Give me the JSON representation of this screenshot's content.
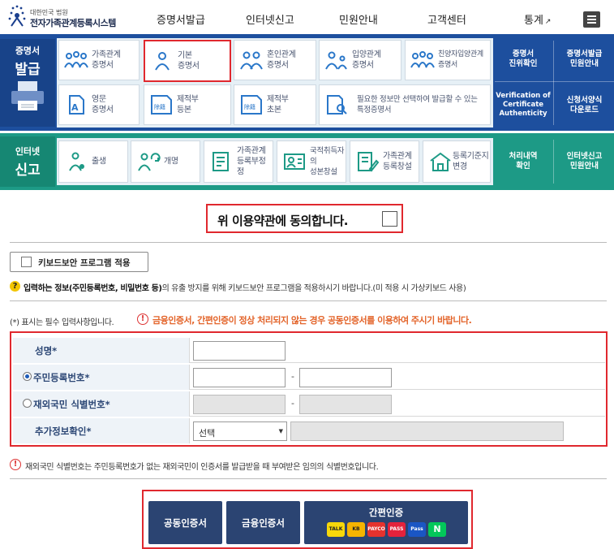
{
  "header": {
    "logo_small": "대한민국 법원",
    "logo_main": "전자가족관계등록시스템",
    "nav": [
      {
        "label": "증명서발급"
      },
      {
        "label": "인터넷신고"
      },
      {
        "label": "민원안내"
      },
      {
        "label": "고객센터"
      },
      {
        "label": "통계",
        "ext": "↗"
      }
    ]
  },
  "cert_section": {
    "title_small": "증명서",
    "title_big": "발급",
    "tiles": [
      {
        "label": "가족관계\n증명서",
        "icon": "family-icon"
      },
      {
        "label": "기본\n증명서",
        "icon": "person-icon",
        "selected": true
      },
      {
        "label": "혼인관계\n증명서",
        "icon": "couple-icon"
      },
      {
        "label": "입양관계\n증명서",
        "icon": "adoption-icon"
      },
      {
        "label": "친양자입양관계\n증명서",
        "icon": "family-icon"
      },
      {
        "label": "영문\n증명서",
        "icon": "english-doc-icon"
      },
      {
        "label": "제적부\n등본",
        "icon": "register-icon"
      },
      {
        "label": "제적부\n초본",
        "icon": "register-icon"
      },
      {
        "label": "필요한 정보만 선택하여 발급할 수 있는\n특정증명서",
        "icon": "search-doc-icon"
      }
    ],
    "side": [
      {
        "label": "증명서\n진위확인"
      },
      {
        "label": "증명서발급\n민원안내"
      },
      {
        "label": "Verification of\nCertificate\nAuthenticity"
      },
      {
        "label": "신청서양식\n다운로드"
      }
    ]
  },
  "report_section": {
    "title_small": "인터넷",
    "title_big": "신고",
    "tiles": [
      {
        "label": "출생",
        "icon": "birth-icon"
      },
      {
        "label": "개명",
        "icon": "rename-icon"
      },
      {
        "label": "가족관계\n등록부정정",
        "icon": "form-icon"
      },
      {
        "label": "국적취득자의\n성본창설",
        "icon": "id-card-icon"
      },
      {
        "label": "가족관계\n등록창설",
        "icon": "form-edit-icon"
      },
      {
        "label": "등록기준지\n변경",
        "icon": "house-icon"
      }
    ],
    "side": [
      {
        "label": "처리내역\n확인"
      },
      {
        "label": "인터넷신고\n민원안내"
      }
    ]
  },
  "agreement": {
    "label": "위 이용약관에 동의합니다."
  },
  "keyboard_security": {
    "label": "키보드보안 프로그램 적용"
  },
  "info_notice": {
    "lead": "입력하는 정보",
    "bold": "(주민등록번호, 비밀번호 등)",
    "rest": "의 유출 방지를 위해 키보드보안 프로그램을 적용하시기 바랍니다.(미 적용 시 가상키보드 사용)"
  },
  "required_note": "(*) 표시는 필수 입력사항입니다.",
  "cert_warning": "금융인증서, 간편인증이 정상 처리되지 않는 경우 공동인증서를 이용하여 주시기 바랍니다.",
  "form": {
    "name_label": "성명",
    "rrn_label": "주민등록번호",
    "foreign_label": "재외국민 식별번호",
    "extra_label": "추가정보확인",
    "required_mark": "*",
    "dash": "-",
    "select_value": "선택"
  },
  "foreign_notice": "재외국민 식별번호는 주민등록번호가 없는 재외국민이 인증서를 발급받을 때 부여받은 임의의 식별번호입니다.",
  "auth_buttons": {
    "joint": "공동인증서",
    "financial": "금융인증서",
    "simple": "간편인증",
    "brands": [
      {
        "name": "TALK",
        "color": "#f7d80a"
      },
      {
        "name": "KB",
        "color": "#f5b400"
      },
      {
        "name": "PAYCO",
        "color": "#e5322e"
      },
      {
        "name": "PASS",
        "color": "#e4223c"
      },
      {
        "name": "Pass",
        "color": "#1a56c4"
      },
      {
        "name": "N",
        "color": "#03c75a"
      }
    ]
  },
  "colors": {
    "cert_band": "#1d4f9e",
    "report_band": "#1d9a86",
    "highlight": "#e0282e",
    "auth_button": "#2b4472",
    "warning": "#e3642a"
  }
}
